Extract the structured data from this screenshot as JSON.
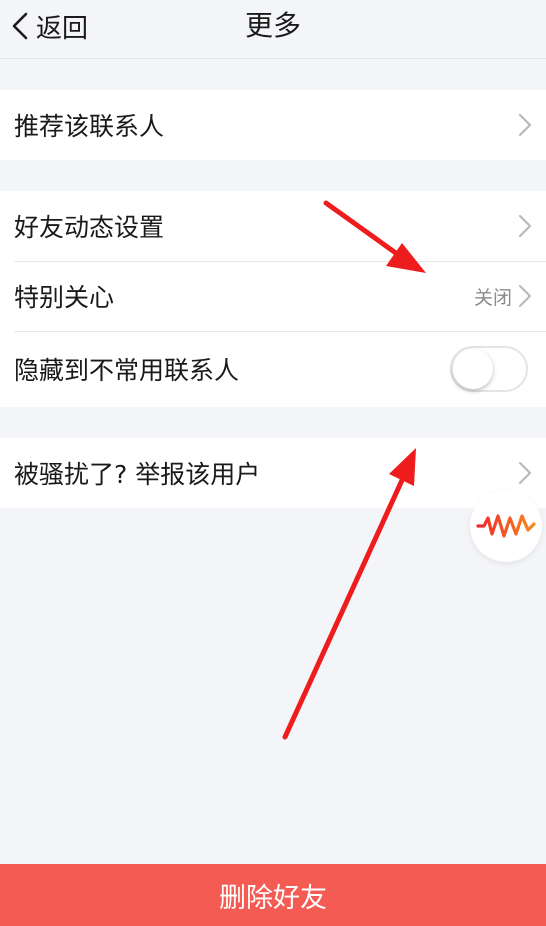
{
  "nav": {
    "back_label": "返回",
    "title": "更多"
  },
  "groups": [
    {
      "rows": [
        {
          "label": "推荐该联系人",
          "control": "chevron"
        }
      ]
    },
    {
      "rows": [
        {
          "label": "好友动态设置",
          "control": "chevron"
        },
        {
          "label": "特别关心",
          "value": "关闭",
          "control": "chevron"
        },
        {
          "label": "隐藏到不常用联系人",
          "control": "toggle",
          "toggle_on": false
        }
      ]
    },
    {
      "rows": [
        {
          "label": "被骚扰了? 举报该用户",
          "control": "chevron"
        }
      ]
    }
  ],
  "delete_button": {
    "label": "删除好友"
  },
  "colors": {
    "background": "#f4f5f8",
    "delete": "#f45c53",
    "annotation": "#ee1c1c"
  },
  "icons": {
    "back": "chevron-left-icon",
    "row": "chevron-right-icon",
    "float": "sound-wave-icon"
  }
}
